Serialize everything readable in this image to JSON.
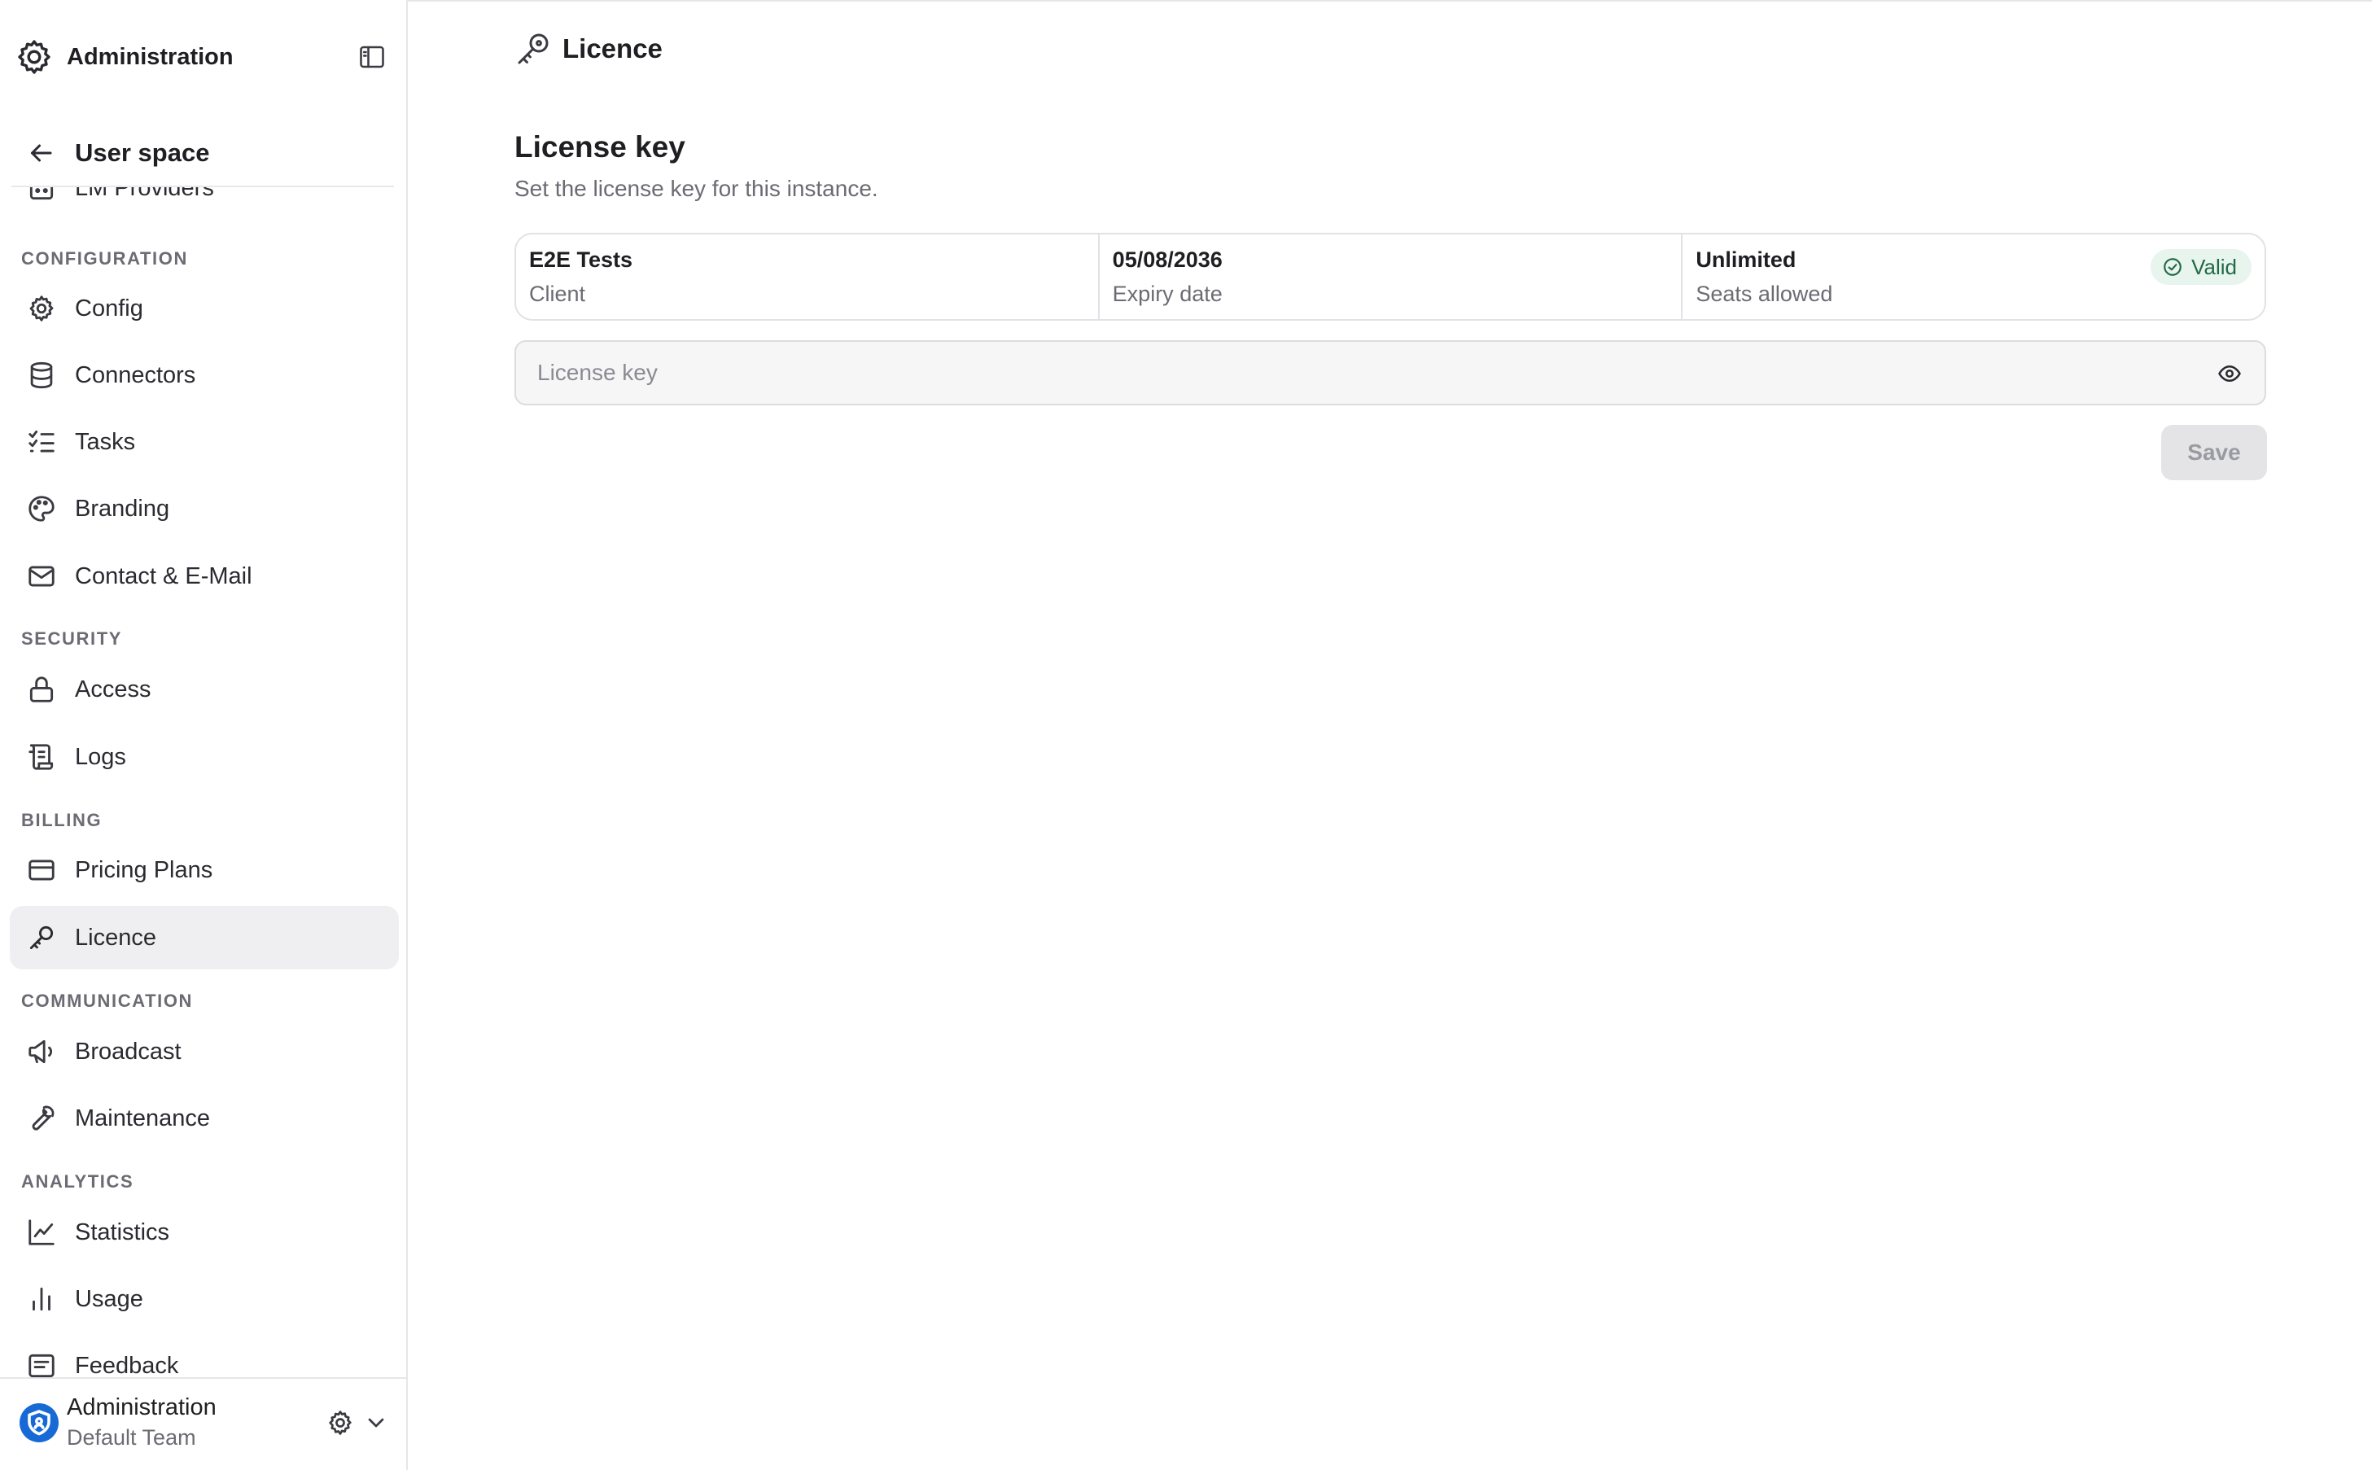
{
  "sidebar": {
    "title": "Administration",
    "back_label": "User space",
    "partial_item": {
      "label": "LM Providers",
      "icon": "bot-icon"
    },
    "sections": [
      {
        "label": "CONFIGURATION",
        "items": [
          {
            "label": "Config",
            "icon": "gear-icon"
          },
          {
            "label": "Connectors",
            "icon": "database-icon"
          },
          {
            "label": "Tasks",
            "icon": "list-checks-icon"
          },
          {
            "label": "Branding",
            "icon": "palette-icon"
          },
          {
            "label": "Contact & E-Mail",
            "icon": "mail-icon"
          }
        ]
      },
      {
        "label": "SECURITY",
        "items": [
          {
            "label": "Access",
            "icon": "lock-icon"
          },
          {
            "label": "Logs",
            "icon": "scroll-icon"
          }
        ]
      },
      {
        "label": "BILLING",
        "items": [
          {
            "label": "Pricing Plans",
            "icon": "credit-card-icon"
          },
          {
            "label": "Licence",
            "icon": "key-icon",
            "active": true
          }
        ]
      },
      {
        "label": "COMMUNICATION",
        "items": [
          {
            "label": "Broadcast",
            "icon": "megaphone-icon"
          },
          {
            "label": "Maintenance",
            "icon": "wrench-icon"
          }
        ]
      },
      {
        "label": "ANALYTICS",
        "items": [
          {
            "label": "Statistics",
            "icon": "line-chart-icon"
          },
          {
            "label": "Usage",
            "icon": "bar-chart-icon"
          },
          {
            "label": "Feedback",
            "icon": "message-icon"
          }
        ]
      }
    ],
    "footer": {
      "name": "Administration",
      "team": "Default Team"
    }
  },
  "main": {
    "page_title": "Licence",
    "section_title": "License key",
    "section_subtitle": "Set the license key for this instance.",
    "info": [
      {
        "value": "E2E Tests",
        "caption": "Client"
      },
      {
        "value": "05/08/2036",
        "caption": "Expiry date"
      },
      {
        "value": "Unlimited",
        "caption": "Seats allowed"
      }
    ],
    "status_badge": "Valid",
    "license_input": {
      "value": "",
      "placeholder": "License key"
    },
    "save_label": "Save"
  },
  "colors": {
    "accent": "#1769d6",
    "active_bg": "#efeff1",
    "valid_bg": "#e8f4ee",
    "valid_fg": "#216b45"
  }
}
